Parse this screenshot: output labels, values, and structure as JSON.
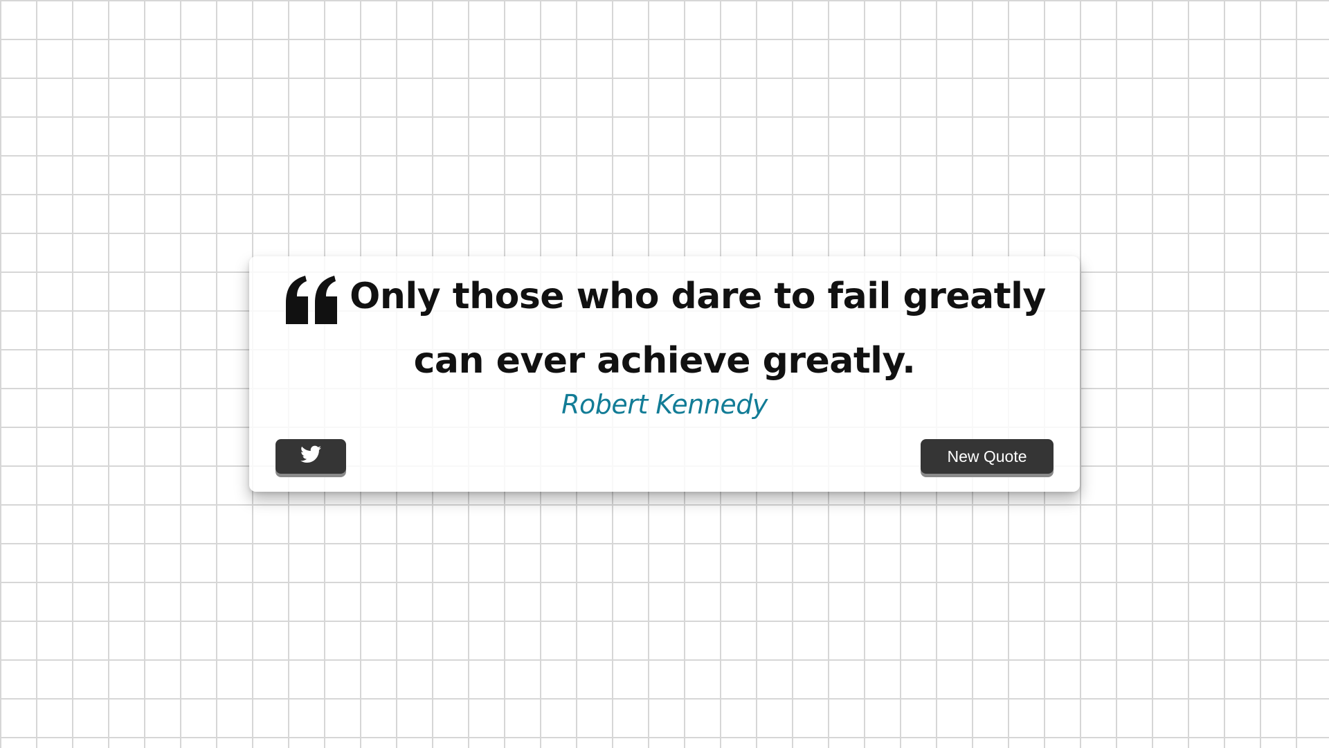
{
  "quote": {
    "text": "Only those who dare to fail greatly can ever achieve greatly.",
    "author": "Robert Kennedy",
    "quote_icon": "quote-left-icon",
    "author_color": "#127c96"
  },
  "actions": {
    "tweet_icon": "twitter-icon",
    "new_quote_label": "New Quote",
    "button_color": "#353535"
  },
  "background": {
    "pattern": "white-brick-wall"
  }
}
